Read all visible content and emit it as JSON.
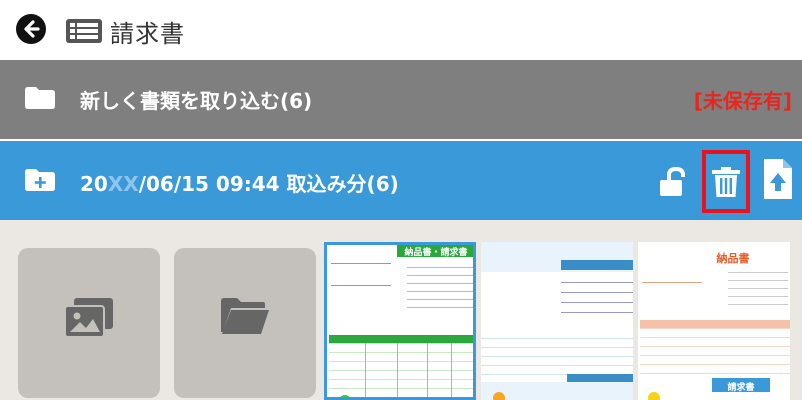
{
  "header": {
    "title": "請求書",
    "back_icon": "back-arrow-icon",
    "doc_icon": "document-list-icon"
  },
  "import_bar": {
    "label": "新しく書類を取り込む(6)",
    "unsaved_label": "[未保存有]",
    "icon": "folder-icon"
  },
  "batch": {
    "label_pre": "20",
    "label_obscured": "XX",
    "label_post": "/06/15 09:44 取込み分(6)",
    "icons": [
      "folder-add-icon",
      "unlock-icon",
      "trash-icon",
      "upload-icon"
    ]
  },
  "tiles": [
    {
      "name": "gallery-icon"
    },
    {
      "name": "open-folder-icon"
    }
  ],
  "thumbnails": [
    {
      "heading": "納品書・請求書",
      "accent": "#2aa73d",
      "selected": true
    },
    {
      "heading": "",
      "accent": "#3a8ec8",
      "selected": false
    },
    {
      "heading": "納品書",
      "heading_bottom": "請求書",
      "accent": "#e95c2a",
      "selected": false
    }
  ],
  "colors": {
    "header_bg": "#ffffff",
    "import_bar_bg": "#7f7f7f",
    "batch_bar_bg": "#3a9ad9",
    "unsaved_text": "#e8261e",
    "highlight_box": "#e8131c",
    "content_bg": "#ebe7e2"
  }
}
